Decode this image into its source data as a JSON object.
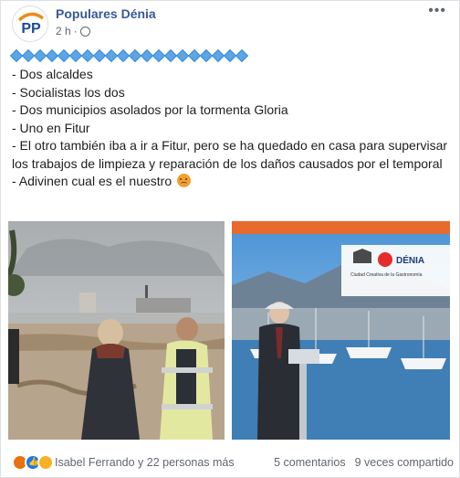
{
  "header": {
    "page_name": "Populares Dénia",
    "timestamp": "2 h",
    "avatar_text": "PP",
    "more_label": "•••"
  },
  "post": {
    "decoration": "blue-diamond row",
    "lines": [
      "- Dos alcaldes",
      "- Socialistas los dos",
      "- Dos municipios asolados por la tormenta Gloria",
      "- Uno en Fitur",
      "- El otro también iba a ir a Fitur, pero se ha quedado en casa para supervisar los trabajos de limpieza y reparación de los daños causados por el temporal",
      "- Adivinen cual es el nuestro"
    ],
    "emoji": "angry-face"
  },
  "photos": {
    "left": {
      "description_icon": "storm-beach-photo"
    },
    "right": {
      "description_icon": "fitur-speech-photo",
      "banner_brand": "DÉNIA",
      "banner_text": "Ciudad Creativa de la Gastronomía"
    }
  },
  "footer": {
    "reactions": [
      "angry",
      "like",
      "haha"
    ],
    "names": "Isabel Ferrando y 22 personas más",
    "comments": "5 comentarios",
    "shares": "9 veces compartido"
  },
  "colors": {
    "link": "#385898",
    "meta": "#606770",
    "like": "#1877f2",
    "angry": "#e9710f"
  }
}
